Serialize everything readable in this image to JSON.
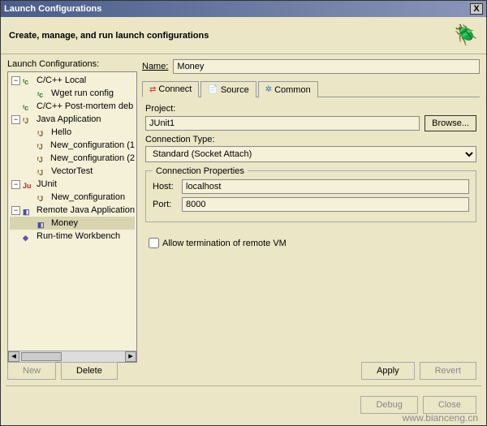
{
  "window": {
    "title": "Launch Configurations",
    "close": "X"
  },
  "header": {
    "text": "Create, manage, and run launch configurations"
  },
  "left": {
    "label": "Launch Configurations:",
    "tree": [
      {
        "label": "C/C++ Local",
        "icon": "c",
        "depth": 0,
        "expanded": true
      },
      {
        "label": "Wget run config",
        "icon": "c",
        "depth": 1
      },
      {
        "label": "C/C++ Post-mortem deb",
        "icon": "c",
        "depth": 0
      },
      {
        "label": "Java Application",
        "icon": "j",
        "depth": 0,
        "expanded": true
      },
      {
        "label": "Hello",
        "icon": "j",
        "depth": 1
      },
      {
        "label": "New_configuration (1",
        "icon": "j",
        "depth": 1
      },
      {
        "label": "New_configuration (2",
        "icon": "j",
        "depth": 1
      },
      {
        "label": "VectorTest",
        "icon": "j",
        "depth": 1
      },
      {
        "label": "JUnit",
        "icon": "ju",
        "depth": 0,
        "expanded": true,
        "icontext": "Ju"
      },
      {
        "label": "New_configuration",
        "icon": "j",
        "depth": 1
      },
      {
        "label": "Remote Java Application",
        "icon": "r",
        "depth": 0,
        "expanded": true
      },
      {
        "label": "Money",
        "icon": "r",
        "depth": 1,
        "selected": true
      },
      {
        "label": "Run-time Workbench",
        "icon": "rt",
        "depth": 0,
        "icontext": "◆"
      }
    ]
  },
  "form": {
    "nameLabel": "Name:",
    "nameValue": "Money",
    "tabs": {
      "connect": "Connect",
      "source": "Source",
      "common": "Common"
    },
    "projectLabel": "Project:",
    "projectValue": "JUnit1",
    "browseLabel": "Browse...",
    "connTypeLabel": "Connection Type:",
    "connTypeValue": "Standard (Socket Attach)",
    "propsLegend": "Connection Properties",
    "hostLabel": "Host:",
    "hostValue": "localhost",
    "portLabel": "Port:",
    "portValue": "8000",
    "allowTerm": "Allow termination of remote VM"
  },
  "buttons": {
    "new": "New",
    "delete": "Delete",
    "apply": "Apply",
    "revert": "Revert",
    "debug": "Debug",
    "close": "Close"
  },
  "watermark": "www.bianceng.cn"
}
